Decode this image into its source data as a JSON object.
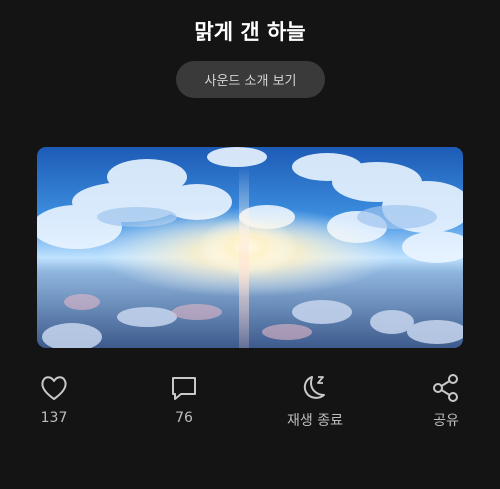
{
  "header": {
    "title": "맑게 갠 하늘"
  },
  "sound_button": {
    "label": "사운드 소개 보기"
  },
  "artwork": {
    "alt": ""
  },
  "actions": [
    {
      "id": "like",
      "icon": "heart-icon",
      "label": "137"
    },
    {
      "id": "comment",
      "icon": "comment-icon",
      "label": "76"
    },
    {
      "id": "sleep-timer",
      "icon": "moon-zz-icon",
      "label": "재생 종료"
    },
    {
      "id": "share",
      "icon": "share-icon",
      "label": "공유"
    }
  ],
  "colors": {
    "background": "#141414",
    "button_bg": "#3a3a3a",
    "icon": "#c8c8c8"
  }
}
